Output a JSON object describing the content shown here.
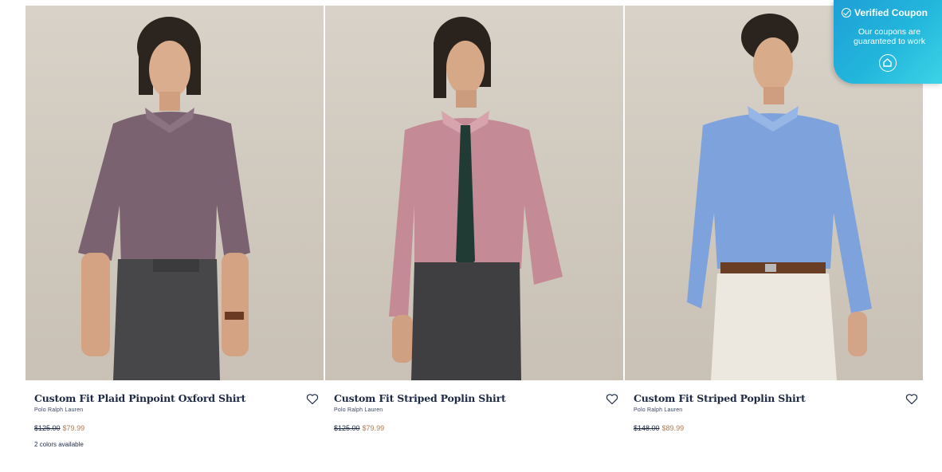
{
  "products": [
    {
      "title": "Custom Fit Plaid Pinpoint Oxford Shirt",
      "brand": "Polo Ralph Lauren",
      "old_price": "$125.00",
      "new_price": "$79.99",
      "colors_note": "2 colors available",
      "shirt_color": "#7a6270",
      "pants_color": "#47474a",
      "image_desc_icon": "product-photo"
    },
    {
      "title": "Custom Fit Striped Poplin Shirt",
      "brand": "Polo Ralph Lauren",
      "old_price": "$125.00",
      "new_price": "$79.99",
      "colors_note": "",
      "shirt_color": "#c48a95",
      "pants_color": "#3f3f42"
    },
    {
      "title": "Custom Fit Striped Poplin Shirt",
      "brand": "Polo Ralph Lauren",
      "old_price": "$148.00",
      "new_price": "$89.99",
      "colors_note": "",
      "shirt_color": "#7ea2dc",
      "pants_color": "#ece8df"
    }
  ],
  "coupon": {
    "title": "Verified Coupon",
    "subtitle": "Our coupons are guaranteed to work",
    "accent": "#23b7dc"
  },
  "colors": {
    "title_text": "#1d2a44",
    "sale_price": "#b07a52",
    "photo_bg": "#d4cdc3"
  },
  "icons": [
    "heart-icon",
    "check-circle-icon",
    "house-icon"
  ]
}
